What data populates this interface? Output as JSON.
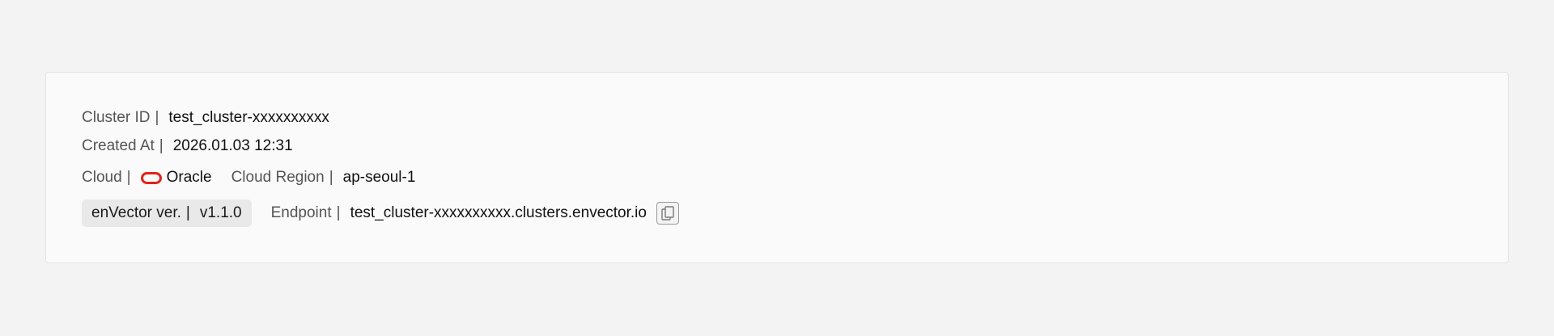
{
  "cluster": {
    "id_label": "Cluster ID",
    "id_value": "test_cluster-xxxxxxxxxx",
    "created_label": "Created At",
    "created_value": "2026.01.03 12:31",
    "cloud_label": "Cloud",
    "cloud_value": "Oracle",
    "cloud_icon": "oracle-logo-icon",
    "region_label": "Cloud Region",
    "region_value": "ap-seoul-1",
    "version_label": "enVector ver.",
    "version_value": "v1.1.0",
    "endpoint_label": "Endpoint",
    "endpoint_value": "test_cluster-xxxxxxxxxx.clusters.envector.io",
    "copy_icon": "copy-icon"
  },
  "separator": "|",
  "colors": {
    "page_bg": "#f3f3f3",
    "card_bg": "#fafafa",
    "oracle_red": "#e2231a",
    "badge_bg": "#e9e9e9"
  }
}
